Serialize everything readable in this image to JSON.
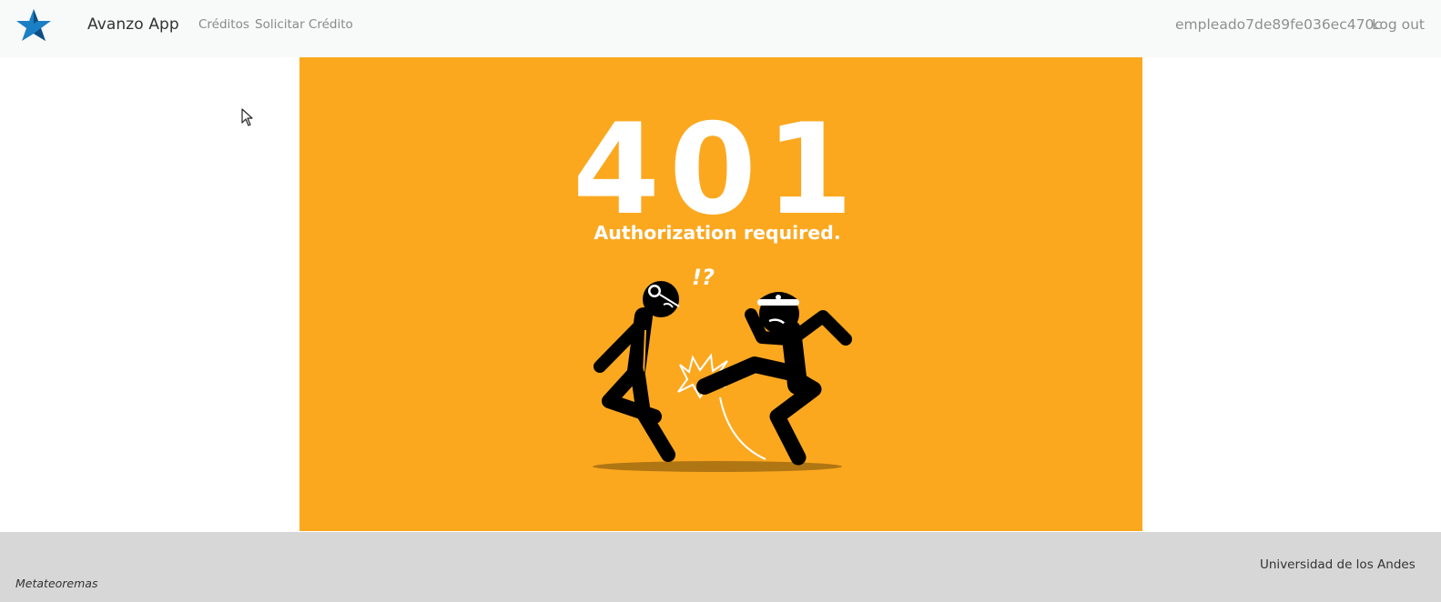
{
  "navbar": {
    "logo_icon": "star-icon",
    "brand": "Avanzo App",
    "links": {
      "creditos": "Créditos",
      "solicitar": "Solicitar Crédito"
    },
    "username": "empleado7de89fe036ec470c",
    "logout": "Log out",
    "colors": {
      "logo": "#1b7fc4",
      "logo_dark": "#0e4f86"
    }
  },
  "error": {
    "code": "401",
    "message": "Authorization required.",
    "exclamation": "!?",
    "background": "#fba81f",
    "illustration_icon": "kick-out-illustration-icon"
  },
  "footer": {
    "university": "Universidad de los Andes",
    "team": "Metateoremas"
  }
}
